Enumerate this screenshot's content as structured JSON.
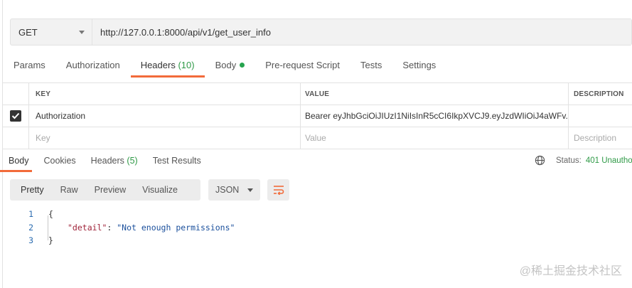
{
  "request": {
    "method": "GET",
    "url": "http://127.0.0.1:8000/api/v1/get_user_info"
  },
  "request_tabs": [
    {
      "label": "Params"
    },
    {
      "label": "Authorization"
    },
    {
      "label": "Headers",
      "count": "(10)"
    },
    {
      "label": "Body"
    },
    {
      "label": "Pre-request Script"
    },
    {
      "label": "Tests"
    },
    {
      "label": "Settings"
    }
  ],
  "headers_table": {
    "columns": {
      "key": "KEY",
      "value": "VALUE",
      "description": "DESCRIPTION"
    },
    "rows": [
      {
        "checked": true,
        "key": "Authorization",
        "value": "Bearer eyJhbGciOiJIUzI1NiIsInR5cCI6IkpXVCJ9.eyJzdWIiOiJ4aWFv...",
        "description": ""
      }
    ],
    "placeholder": {
      "key": "Key",
      "value": "Value",
      "description": "Description"
    }
  },
  "response_tabs": [
    {
      "label": "Body"
    },
    {
      "label": "Cookies"
    },
    {
      "label": "Headers",
      "count": "(5)"
    },
    {
      "label": "Test Results"
    }
  ],
  "status": {
    "label": "Status:",
    "value": "401 Unautho"
  },
  "view_modes": [
    "Pretty",
    "Raw",
    "Preview",
    "Visualize"
  ],
  "format": "JSON",
  "code": {
    "line_numbers": [
      "1",
      "2",
      "3"
    ],
    "open_brace": "{",
    "key": "\"detail\"",
    "colon": ": ",
    "value": "\"Not enough permissions\"",
    "close_brace": "}"
  },
  "watermark": "@稀土掘金技术社区",
  "colors": {
    "accent": "#f26b3a",
    "success": "#2f9a47"
  }
}
